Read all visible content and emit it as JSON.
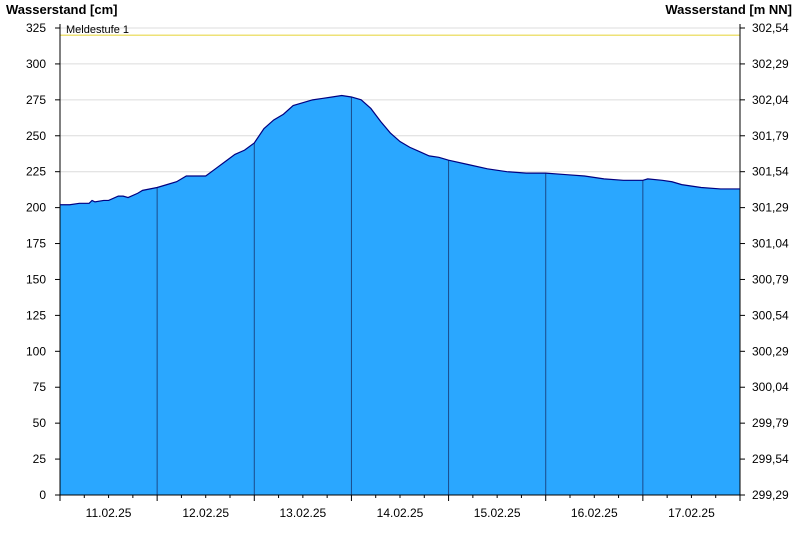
{
  "chart_data": {
    "type": "area",
    "ylabel_left": "Wasserstand [cm]",
    "ylabel_right": "Wasserstand [m NN]",
    "ylim": [
      0,
      325
    ],
    "yticks_left": [
      0,
      25,
      50,
      75,
      100,
      125,
      150,
      175,
      200,
      225,
      250,
      275,
      300,
      325
    ],
    "yticks_right_labels": [
      "299,29",
      "299,54",
      "299,79",
      "300,04",
      "300,29",
      "300,54",
      "300,79",
      "301,04",
      "301,29",
      "301,54",
      "301,79",
      "302,04",
      "302,29",
      "302,54"
    ],
    "xlim": [
      0,
      7
    ],
    "xticks": [
      {
        "x": 0.5,
        "label": "11.02.25"
      },
      {
        "x": 1.5,
        "label": "12.02.25"
      },
      {
        "x": 2.5,
        "label": "13.02.25"
      },
      {
        "x": 3.5,
        "label": "14.02.25"
      },
      {
        "x": 4.5,
        "label": "15.02.25"
      },
      {
        "x": 5.5,
        "label": "16.02.25"
      },
      {
        "x": 6.5,
        "label": "17.02.25"
      }
    ],
    "day_boundaries": [
      1,
      2,
      3,
      4,
      5,
      6
    ],
    "threshold": {
      "label": "Meldestufe 1",
      "value": 320,
      "color": "#e8d84a"
    },
    "fill_color": "#2aa7ff",
    "line_color": "#000080",
    "grid": true,
    "series": [
      {
        "x": [
          0,
          0.1,
          0.2,
          0.3,
          0.33,
          0.36,
          0.45,
          0.5,
          0.6,
          0.65,
          0.7,
          0.8,
          0.85,
          1.0,
          1.1,
          1.2,
          1.3,
          1.4,
          1.5,
          1.6,
          1.7,
          1.8,
          1.9,
          2.0,
          2.1,
          2.2,
          2.3,
          2.4,
          2.5,
          2.6,
          2.7,
          2.8,
          2.9,
          3.0,
          3.1,
          3.2,
          3.3,
          3.4,
          3.5,
          3.6,
          3.7,
          3.8,
          3.9,
          4.0,
          4.2,
          4.4,
          4.6,
          4.8,
          5.0,
          5.2,
          5.4,
          5.6,
          5.8,
          6.0,
          6.05,
          6.2,
          6.3,
          6.4,
          6.6,
          6.8,
          7.0
        ],
        "y": [
          202,
          202,
          203,
          203,
          205,
          204,
          205,
          205,
          208,
          208,
          207,
          210,
          212,
          214,
          216,
          218,
          222,
          222,
          222,
          227,
          232,
          237,
          240,
          245,
          255,
          261,
          265,
          271,
          273,
          275,
          276,
          277,
          278,
          277,
          275,
          269,
          260,
          252,
          246,
          242,
          239,
          236,
          235,
          233,
          230,
          227,
          225,
          224,
          224,
          223,
          222,
          220,
          219,
          219,
          220,
          219,
          218,
          216,
          214,
          213,
          213
        ]
      }
    ]
  }
}
